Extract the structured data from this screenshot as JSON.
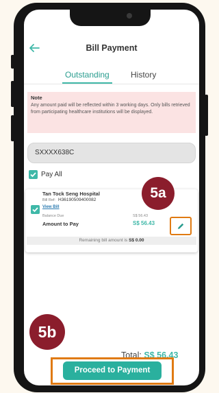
{
  "header": {
    "title": "Bill Payment",
    "back_icon": "arrow-left-icon"
  },
  "tabs": [
    {
      "label": "Outstanding",
      "active": true
    },
    {
      "label": "History",
      "active": false
    }
  ],
  "note": {
    "title": "Note",
    "text": "Any amount paid will be reflected within 3 working days. Only bills retrieved from participating healthcare institutions will be displayed."
  },
  "id_field": {
    "value": "SXXXX638C"
  },
  "pay_all": {
    "label": "Pay All",
    "checked": true
  },
  "bill": {
    "checked": true,
    "hospital": "Tan Tock Seng Hospital",
    "ref_label": "Bill Ref:",
    "ref": "H36190509400082",
    "view_bill": "View Bill",
    "balance_label": "Balance Due",
    "balance_value": "S$ 56.43",
    "amount_label": "Amount to Pay",
    "amount_value": "S$ 56.43",
    "remaining_text": "Remaining bill amount is",
    "remaining_value": "S$ 0.00",
    "edit_icon": "pencil-icon"
  },
  "annotations": {
    "step_a": "5a",
    "step_b": "5b"
  },
  "footer": {
    "total_label": "Total:",
    "total_value": "S$ 56.43",
    "proceed_label": "Proceed to Payment"
  },
  "colors": {
    "accent": "#3fb8a8",
    "button": "#2ab09e",
    "highlight_outline": "#e07a12",
    "badge": "#8b1d2c",
    "note_bg": "#fbe3e3"
  }
}
